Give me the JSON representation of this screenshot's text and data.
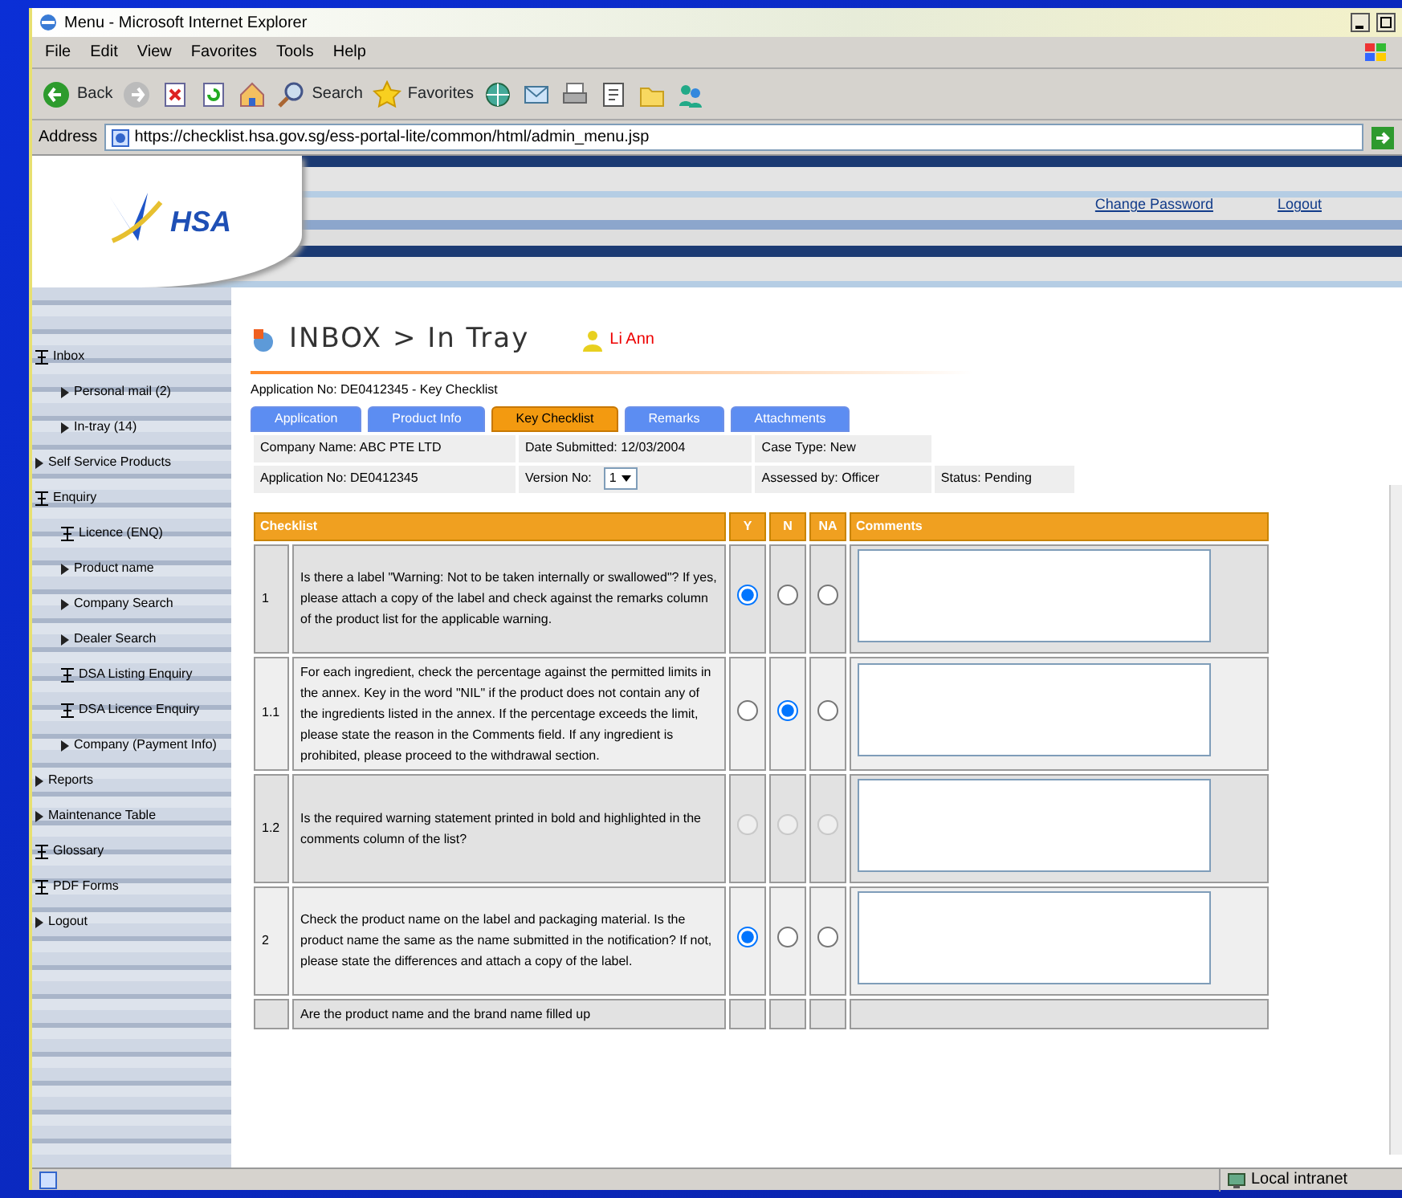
{
  "window": {
    "title": "Menu - Microsoft Internet Explorer"
  },
  "menu_bar": [
    "File",
    "Edit",
    "View",
    "Favorites",
    "Tools",
    "Help"
  ],
  "toolbar": [
    {
      "kind": "back",
      "label": "Back"
    },
    {
      "kind": "forward"
    },
    {
      "kind": "stop"
    },
    {
      "kind": "refresh"
    },
    {
      "kind": "home"
    },
    {
      "kind": "search",
      "label": "Search"
    },
    {
      "kind": "favorites",
      "label": "Favorites"
    },
    {
      "kind": "media"
    },
    {
      "kind": "mail"
    },
    {
      "kind": "print"
    },
    {
      "kind": "edit"
    },
    {
      "kind": "folder"
    },
    {
      "kind": "messenger"
    }
  ],
  "address_bar": {
    "label": "Address",
    "url": "https://checklist.hsa.gov.sg/ess-portal-lite/common/html/admin_menu.jsp"
  },
  "header": {
    "logo": "HSA",
    "links": [
      "Change Password",
      "Logout"
    ]
  },
  "sidebar": {
    "items": [
      {
        "kind": "group",
        "label": "Inbox",
        "children": [
          {
            "kind": "link",
            "label": "Personal mail (2)"
          },
          {
            "kind": "link",
            "label": "In-tray (14)"
          }
        ]
      },
      {
        "kind": "link",
        "label": "Self Service Products"
      },
      {
        "kind": "group",
        "label": "Enquiry",
        "children": [
          {
            "kind": "group",
            "label": "Licence (ENQ)"
          },
          {
            "kind": "link",
            "label": "Product name"
          },
          {
            "kind": "link",
            "label": "Company Search"
          },
          {
            "kind": "link",
            "label": "Dealer Search"
          },
          {
            "kind": "group",
            "label": "DSA Listing Enquiry"
          },
          {
            "kind": "group",
            "label": "DSA Licence Enquiry"
          },
          {
            "kind": "link",
            "label": "Company (Payment Info)"
          }
        ]
      },
      {
        "kind": "link",
        "label": "Reports"
      },
      {
        "kind": "link",
        "label": "Maintenance Table"
      },
      {
        "kind": "group",
        "label": "Glossary"
      },
      {
        "kind": "group",
        "label": "PDF Forms"
      },
      {
        "kind": "link",
        "label": "Logout"
      }
    ]
  },
  "page": {
    "title": "INBOX > In Tray",
    "user": "Li Ann",
    "subtitle": "Application No: DE0412345 - Key Checklist"
  },
  "tabs": [
    {
      "label": "Application",
      "selected": false
    },
    {
      "label": "Product Info",
      "selected": false
    },
    {
      "label": "Key Checklist",
      "selected": true
    },
    {
      "label": "Remarks",
      "selected": false
    },
    {
      "label": "Attachments",
      "selected": false
    }
  ],
  "info_rows": [
    {
      "cells": [
        "Company Name: ABC PTE LTD",
        "Date Submitted: 12/03/2004",
        "Case Type: New"
      ]
    },
    {
      "cells": [
        "Application No: DE0412345",
        "Version No:",
        "Assessed by: Officer",
        "Status: Pending"
      ],
      "version": "1"
    }
  ],
  "checklist": {
    "columns": [
      "Checklist",
      "Y",
      "N",
      "NA",
      "Comments"
    ],
    "rows": [
      {
        "number": "1",
        "text": "Is there a label \"Warning: Not to be taken internally or swallowed\"? If yes, please attach a copy of the label and check against the remarks column of the product list for the applicable warning.",
        "disabled": false,
        "choices": [
          {
            "selected": true
          },
          {
            "selected": false
          },
          {
            "selected": false
          }
        ]
      },
      {
        "number": "1.1",
        "text": "For each ingredient, check the percentage against the permitted limits in the annex. Key in the word \"NIL\" if the product does not contain any of the ingredients listed in the annex. If the percentage exceeds the limit, please state the reason in the Comments field. If any ingredient is prohibited, please proceed to the withdrawal section.",
        "disabled": false,
        "choices": [
          {
            "selected": false
          },
          {
            "selected": true
          },
          {
            "selected": false
          }
        ]
      },
      {
        "number": "1.2",
        "text": "Is the required warning statement printed in bold and highlighted in the comments column of the list?",
        "disabled": true,
        "choices": [
          {
            "selected": false
          },
          {
            "selected": false
          },
          {
            "selected": false
          }
        ]
      },
      {
        "number": "2",
        "text": "Check the product name on the label and packaging material. Is the product name the same as the name submitted in the notification? If not, please state the differences and attach a copy of the label.",
        "disabled": false,
        "choices": [
          {
            "selected": true
          },
          {
            "selected": false
          },
          {
            "selected": false
          }
        ]
      },
      {
        "number": "",
        "text": "Are the product name and the brand name filled up"
      }
    ]
  },
  "status_bar": {
    "zone": "Local intranet"
  }
}
